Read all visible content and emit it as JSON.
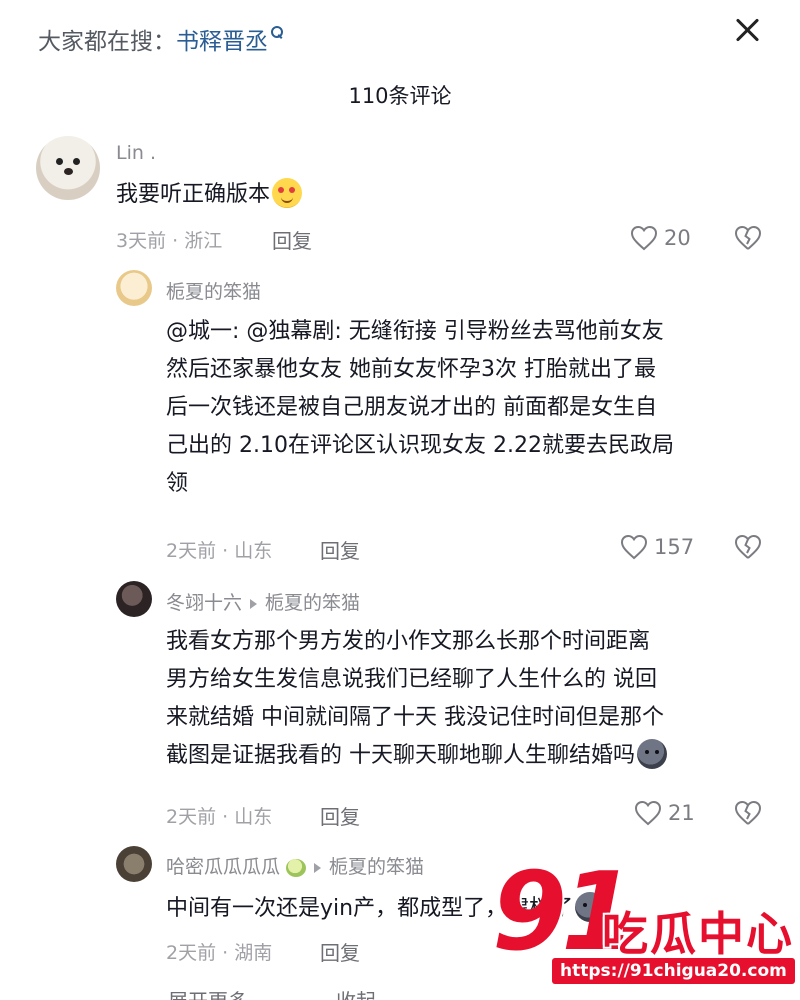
{
  "header": {
    "search_prefix": "大家都在搜：",
    "search_term": "书释晋丞",
    "comment_count": "110条评论"
  },
  "comments": [
    {
      "user": "Lin .",
      "text": "我要听正确版本",
      "emoji": "smiling-face-with-heart-eyes",
      "meta": "3天前 · 浙江",
      "reply_label": "回复",
      "likes": "20"
    },
    {
      "user": "栀夏的笨猫",
      "lines": [
        "@城一: @独幕剧: 无缝衔接 引导粉丝去骂他前女友",
        "然后还家暴他女友 她前女友怀孕3次 打胎就出了最",
        "后一次钱还是被自己朋友说才出的 前面都是女生自",
        "己出的 2.10在评论区认识现女友 2.22就要去民政局",
        "领"
      ],
      "meta": "2天前 · 山东",
      "reply_label": "回复",
      "likes": "157"
    },
    {
      "user": "冬翊十六",
      "reply_to": "栀夏的笨猫",
      "lines": [
        "我看女方那个男方发的小作文那么长那个时间距离",
        "男方给女生发信息说我们已经聊了人生什么的 说回",
        "来就结婚 中间就间隔了十天 我没记住时间但是那个",
        "截图是证据我看的 十天聊天聊地聊人生聊结婚吗"
      ],
      "emoji": "dark-face",
      "meta": "2天前 · 山东",
      "reply_label": "回复",
      "likes": "21"
    },
    {
      "user": "哈密瓜瓜瓜瓜",
      "reply_to": "栀夏的笨猫",
      "text": "中间有一次还是yin产，都成型了，建档了",
      "emoji": "dark-face",
      "meta": "2天前 · 湖南",
      "reply_label": "回复"
    }
  ],
  "footer": {
    "expand_label": "展开更多",
    "collapse_label": "收起"
  },
  "watermark": {
    "number": "91",
    "name": "吃瓜中心",
    "url": "https://91chigua20.com"
  },
  "colors": {
    "link_blue": "#2a5d94",
    "text": "#161823",
    "muted": "#a0a1a6",
    "watermark_red": "#e60f2d"
  }
}
